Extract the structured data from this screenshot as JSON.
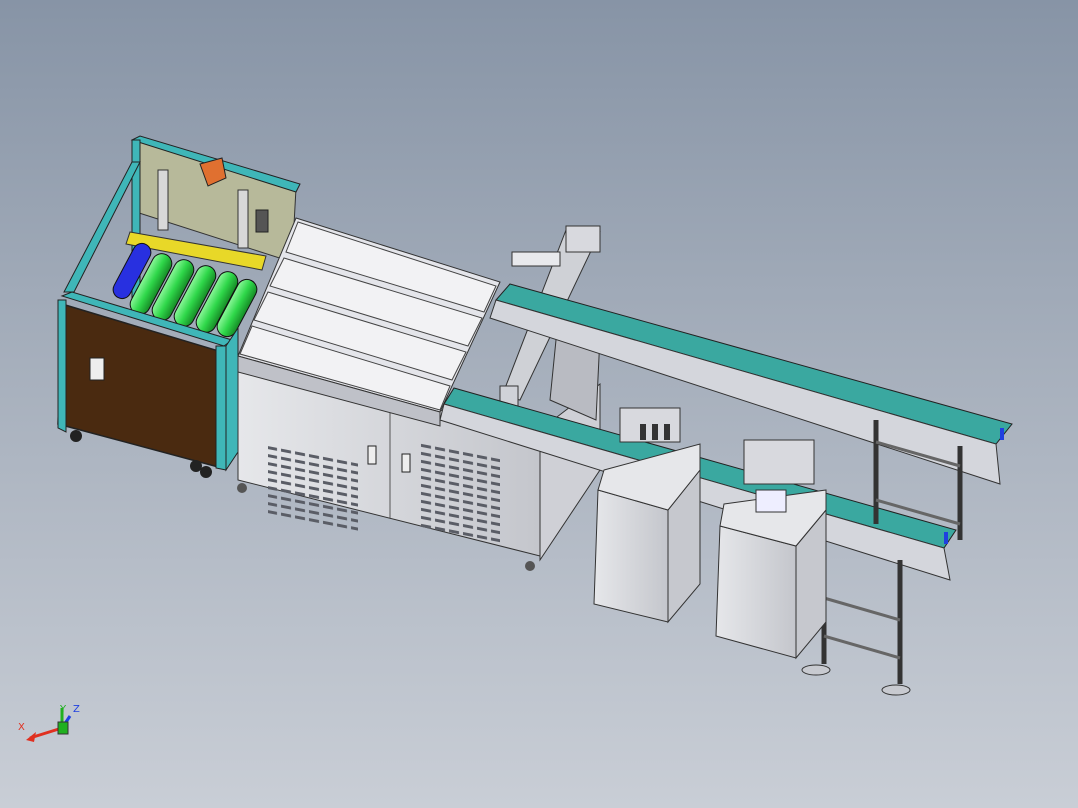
{
  "viewport": {
    "background_top": "#8794a6",
    "background_bottom": "#c9ced6"
  },
  "triad": {
    "x_label": "X",
    "y_label": "Y",
    "z_label": "Z",
    "x_color": "#e03020",
    "y_color": "#20b020",
    "z_color": "#2040e0"
  },
  "colors": {
    "frame_teal": "#3fb6b8",
    "panel_brown": "#4a2a10",
    "roller_green": "#2fd84a",
    "roller_blue": "#2830e0",
    "rail_yellow": "#e8d828",
    "handle_orange": "#e07030",
    "cabinet_gray": "#dcdde2",
    "belt_teal": "#3aa8a0",
    "steel": "#c8cad0"
  }
}
